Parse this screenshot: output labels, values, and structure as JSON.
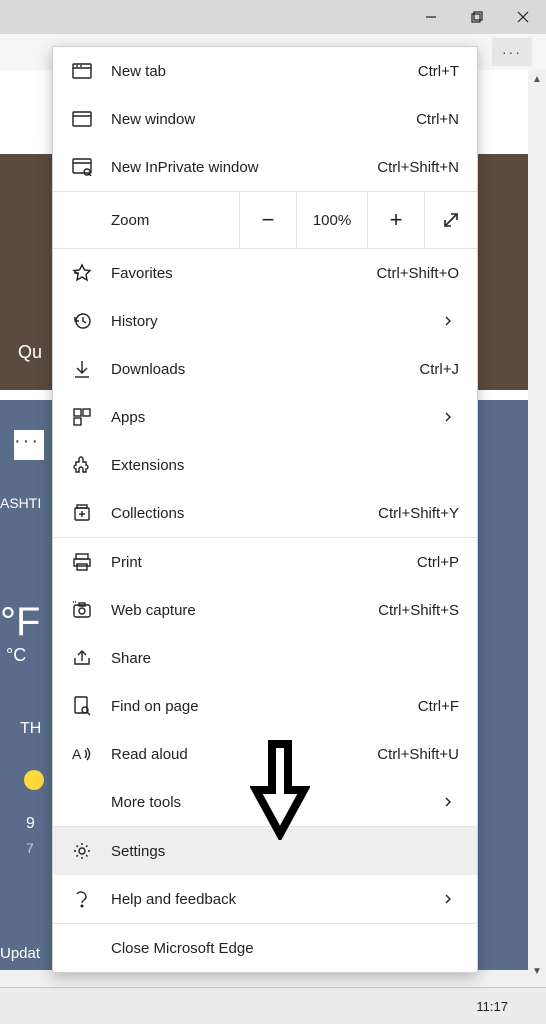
{
  "titlebar": {
    "min": "–",
    "max": "❐",
    "close": "✕"
  },
  "browser": {
    "kebab": "···",
    "bgellipsis": "···"
  },
  "bgtext": {
    "qu": "Qu",
    "ash": "ASHTI",
    "degF": "°F",
    "degC": "°C",
    "th": "TH",
    "n9": "9",
    "n7": "7",
    "up": "Updat"
  },
  "menu": {
    "new_tab": {
      "label": "New tab",
      "shortcut": "Ctrl+T"
    },
    "new_window": {
      "label": "New window",
      "shortcut": "Ctrl+N"
    },
    "inprivate": {
      "label": "New InPrivate window",
      "shortcut": "Ctrl+Shift+N"
    },
    "zoom": {
      "label": "Zoom",
      "value": "100%"
    },
    "favorites": {
      "label": "Favorites",
      "shortcut": "Ctrl+Shift+O"
    },
    "history": {
      "label": "History"
    },
    "downloads": {
      "label": "Downloads",
      "shortcut": "Ctrl+J"
    },
    "apps": {
      "label": "Apps"
    },
    "extensions": {
      "label": "Extensions"
    },
    "collections": {
      "label": "Collections",
      "shortcut": "Ctrl+Shift+Y"
    },
    "print": {
      "label": "Print",
      "shortcut": "Ctrl+P"
    },
    "webcapture": {
      "label": "Web capture",
      "shortcut": "Ctrl+Shift+S"
    },
    "share": {
      "label": "Share"
    },
    "find": {
      "label": "Find on page",
      "shortcut": "Ctrl+F"
    },
    "readaloud": {
      "label": "Read aloud",
      "shortcut": "Ctrl+Shift+U"
    },
    "moretools": {
      "label": "More tools"
    },
    "settings": {
      "label": "Settings"
    },
    "help": {
      "label": "Help and feedback"
    },
    "close": {
      "label": "Close Microsoft Edge"
    }
  },
  "taskbar": {
    "clock": "11:17"
  }
}
